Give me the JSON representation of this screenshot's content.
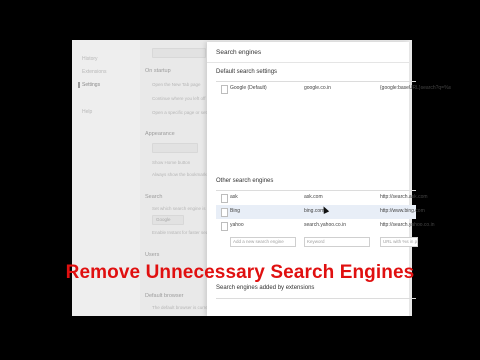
{
  "background_settings": {
    "nav": [
      "History",
      "Extensions",
      "Settings",
      "Help"
    ],
    "on_startup": "On startup",
    "startup_options": [
      "Open the New Tab page",
      "Continue where you left off",
      "Open a specific page or set of pages."
    ],
    "appearance": "Appearance",
    "appearance_options": [
      "Show Home button",
      "Always show the bookmarks bar"
    ],
    "search": "Search",
    "search_desc": "Set which search engine is used when searching from the omnibox.",
    "search_select": "Google",
    "enable_instant": "Enable Instant for faster searching",
    "users": "Users",
    "default_browser": "Default browser",
    "default_browser_desc": "The default browser is currently..."
  },
  "dialog": {
    "title": "Search engines",
    "default_section": "Default search settings",
    "default_engines": [
      {
        "name": "Google (Default)",
        "keyword": "google.co.in",
        "url": "{google:baseURL}search?q=%s"
      }
    ],
    "other_section": "Other search engines",
    "other_engines": [
      {
        "name": "ask",
        "keyword": "ask.com",
        "url": "http://search.ask.com"
      },
      {
        "name": "Bing",
        "keyword": "bing.com",
        "url": "http://www.bing.com"
      },
      {
        "name": "yahoo",
        "keyword": "search.yahoo.co.in",
        "url": "http://search.yahoo.co.in"
      }
    ],
    "add_placeholder_name": "Add a new search engine",
    "add_placeholder_keyword": "Keyword",
    "add_placeholder_url": "URL with %s in place of query",
    "extensions_section": "Search engines added by extensions"
  },
  "overlay": {
    "caption": "Remove Unnecessary Search Engines",
    "color": "#e01010"
  }
}
